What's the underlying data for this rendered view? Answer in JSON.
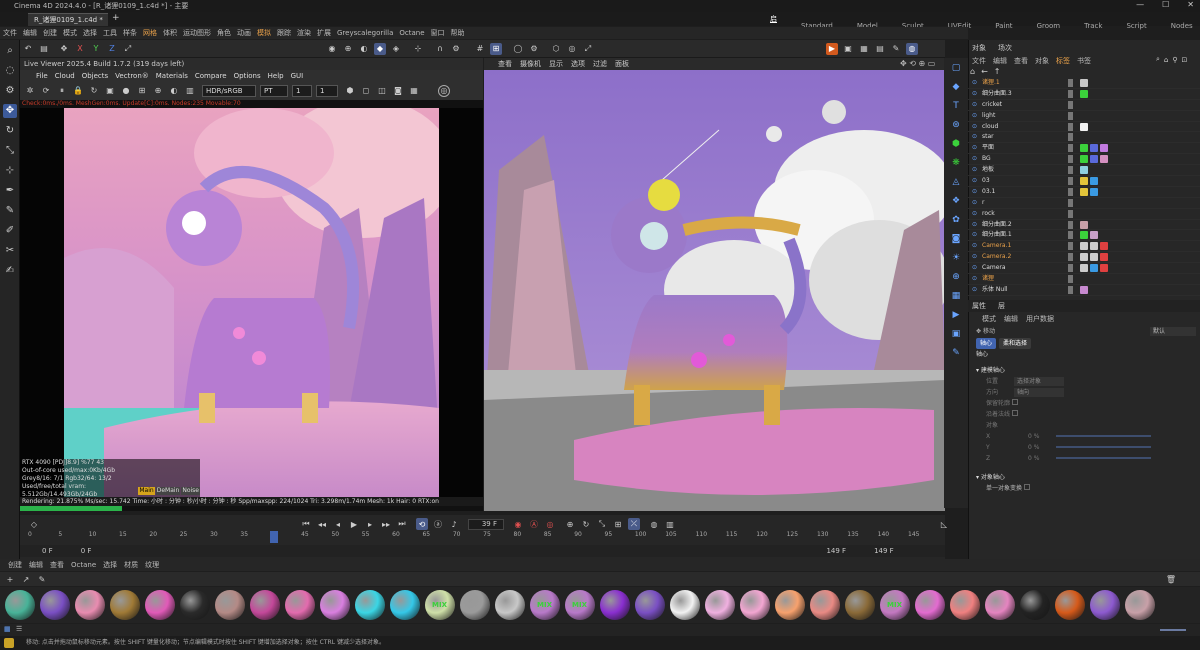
{
  "window": {
    "title": "Cinema 4D 2024.4.0 - [R_诸狸0109_1.c4d *] - 主要",
    "doc_tab": "R_诸狸0109_1.c4d *",
    "add_tab": "+",
    "min": "—",
    "max": "☐",
    "close": "✕"
  },
  "layouts": [
    "启动",
    "Standard",
    "Model",
    "Sculpt",
    "UVEdit",
    "Paint",
    "Groom",
    "Track",
    "Script",
    "Nodes"
  ],
  "menu": [
    "文件",
    "编辑",
    "创建",
    "模式",
    "选择",
    "工具",
    "样条",
    "网格",
    "体积",
    "运动图形",
    "角色",
    "动画",
    "模拟",
    "跟踪",
    "渲染",
    "扩展",
    "Greyscalegorilla",
    "Octane",
    "窗口",
    "帮助"
  ],
  "main_toolbar": {
    "xyz": [
      "X",
      "Y",
      "Z"
    ]
  },
  "live_viewer": {
    "title": "Live Viewer 2025.4 Build 1.7.2 (319 days left)",
    "menu": [
      "File",
      "Cloud",
      "Objects",
      "Vectron®",
      "Materials",
      "Compare",
      "Options",
      "Help",
      "GUI"
    ],
    "colorspace": "HDR/sRGB",
    "mode": "PT",
    "val1": "1",
    "val2": "1",
    "status": "Check:0ms./0ms. MeshGen:0ms. Update[C]:0ms. Nodes:235 Movable:70",
    "info": [
      "RTX 4090 [PDJ]8.9]    %77    43",
      "Out-of-core used/max:0Kb/4Gb",
      "Grey8/16: 7/1         Rgb32/64: 13/2",
      "Used/free/total vram: 5.512Gb/14.493Gb/24Gb"
    ],
    "info_tags": [
      "Main",
      "DeMain",
      "Noise"
    ],
    "render_line": "Rendering: 21.875%   Ms/sec: 15.742   Time: 小时 : 分钟 : 秒/小时 : 分钟 : 秒   Spp/maxspp: 224/1024   Tri: 3.298m/1.74m   Mesh: 1k   Hair: 0   RTX:on",
    "progress": 0.22
  },
  "viewport": {
    "menu": [
      "查看",
      "摄像机",
      "显示",
      "选项",
      "过滤",
      "面板"
    ]
  },
  "timeline": {
    "current": "39 F",
    "ticks": [
      "0",
      "5",
      "10",
      "15",
      "20",
      "25",
      "30",
      "35",
      "40",
      "45",
      "50",
      "55",
      "60",
      "65",
      "70",
      "75",
      "80",
      "85",
      "90",
      "95",
      "100",
      "105",
      "110",
      "115",
      "120",
      "125",
      "130",
      "135",
      "140",
      "145"
    ],
    "start": "0 F",
    "start2": "0 F",
    "end": "149 F",
    "end2": "149 F"
  },
  "material_menu": [
    "创建",
    "编辑",
    "查看",
    "Octane",
    "选择",
    "材质",
    "纹理"
  ],
  "materials": [
    {
      "c": "#48b398",
      "label": ""
    },
    {
      "c": "#7a4fc4",
      "label": ""
    },
    {
      "c": "#e98cb0",
      "label": ""
    },
    {
      "c": "#a07a36",
      "label": ""
    },
    {
      "c": "#e15ab8",
      "label": ""
    },
    {
      "c": "#2a2a2a",
      "label": ""
    },
    {
      "c": "#b48a86",
      "label": ""
    },
    {
      "c": "#c4489a",
      "label": ""
    },
    {
      "c": "#e36bae",
      "label": ""
    },
    {
      "c": "#d97fe0",
      "label": ""
    },
    {
      "c": "#3ad6e5",
      "label": ""
    },
    {
      "c": "#34c8e8",
      "label": ""
    },
    {
      "c": "#cfe0a8",
      "label": "MIX"
    },
    {
      "c": "#9a9a9a",
      "label": ""
    },
    {
      "c": "#c8c8c8",
      "label": ""
    },
    {
      "c": "#b879c9",
      "label": "MIX"
    },
    {
      "c": "#b879c9",
      "label": "MIX"
    },
    {
      "c": "#8a2fd0",
      "label": ""
    },
    {
      "c": "#7a4fc4",
      "label": ""
    },
    {
      "c": "#f2f2f2",
      "label": ""
    },
    {
      "c": "#f0b0e0",
      "label": ""
    },
    {
      "c": "#f3a6d2",
      "label": ""
    },
    {
      "c": "#f7a16d",
      "label": ""
    },
    {
      "c": "#e98a84",
      "label": ""
    },
    {
      "c": "#8a6a38",
      "label": ""
    },
    {
      "c": "#c478c2",
      "label": "MIX"
    },
    {
      "c": "#e36bd0",
      "label": ""
    },
    {
      "c": "#f08080",
      "label": ""
    },
    {
      "c": "#e584c0",
      "label": ""
    },
    {
      "c": "#232323",
      "label": ""
    },
    {
      "c": "#d65a1a",
      "label": ""
    },
    {
      "c": "#8d5ad0",
      "label": ""
    },
    {
      "c": "#c8a0a8",
      "label": ""
    }
  ],
  "status": "移动: 点击并拖动鼠标移动元素。按住 SHIFT 键量化移动；节点编辑模式时按住 SHIFT 键增加选择对象；按住 CTRL 键减少选择对象。",
  "right_panel": {
    "tabs": [
      "对象",
      "场次"
    ],
    "menu": [
      "文件",
      "编辑",
      "查看",
      "对象",
      "标签",
      "书签"
    ],
    "objects": [
      {
        "name": "诸狸.1",
        "color": "#e9a14a",
        "tags": [
          "#c8c8c8"
        ]
      },
      {
        "name": "细分曲面.3",
        "color": "#ddd",
        "tags": [
          "#3bd13b"
        ]
      },
      {
        "name": "cricket",
        "color": "#ddd",
        "tags": []
      },
      {
        "name": "light",
        "color": "#ddd",
        "tags": []
      },
      {
        "name": "cloud",
        "color": "#ddd",
        "tags": [
          "#f2f2f2"
        ]
      },
      {
        "name": "star",
        "color": "#ddd",
        "tags": []
      },
      {
        "name": "平面",
        "color": "#ddd",
        "tags": [
          "#3bd13b",
          "#5a6adb",
          "#c27be0"
        ]
      },
      {
        "name": "BG",
        "color": "#ddd",
        "tags": [
          "#3bd13b",
          "#5a6adb",
          "#d48fc0"
        ]
      },
      {
        "name": "地板",
        "color": "#ddd",
        "tags": [
          "#8fd0e0"
        ]
      },
      {
        "name": "03",
        "color": "#ddd",
        "tags": [
          "#e3c43a",
          "#3a9ae3"
        ]
      },
      {
        "name": "03.1",
        "color": "#ddd",
        "tags": [
          "#e3c43a",
          "#3a9ae3"
        ]
      },
      {
        "name": "r",
        "color": "#ddd",
        "tags": []
      },
      {
        "name": "rock",
        "color": "#ddd",
        "tags": []
      },
      {
        "name": "细分曲面.2",
        "color": "#ddd",
        "tags": [
          "#c8a0a8"
        ]
      },
      {
        "name": "细分曲面.1",
        "color": "#ddd",
        "tags": [
          "#3bd13b",
          "#c8a0c8"
        ]
      },
      {
        "name": "Camera.1",
        "color": "#e9a14a",
        "tags": [
          "#cccccc",
          "#cccccc",
          "#e04040"
        ]
      },
      {
        "name": "Camera.2",
        "color": "#e9a14a",
        "tags": [
          "#cccccc",
          "#cccccc",
          "#e04040"
        ]
      },
      {
        "name": "Camera",
        "color": "#ddd",
        "tags": [
          "#cccccc",
          "#3a9ae3",
          "#e04040"
        ]
      },
      {
        "name": "诸狸",
        "color": "#e9a14a",
        "tags": []
      },
      {
        "name": "乐体 Null",
        "color": "#ddd",
        "tags": [
          "#c88ad0"
        ]
      }
    ],
    "attr_tabs": [
      "属性",
      "层"
    ],
    "attr_menu": [
      "模式",
      "编辑",
      "用户数据"
    ],
    "tool": "移动",
    "preset": "默认",
    "pills": [
      "轴心",
      "柔和选择"
    ],
    "section": "轴心",
    "group1": "▾ 建模轴心",
    "fields": [
      {
        "k": "位置",
        "v": "选择对象"
      },
      {
        "k": "方向",
        "v": "轴向"
      }
    ],
    "checks": [
      "保留轮廓",
      "沿着法线"
    ],
    "sub": "对象",
    "xyz": [
      {
        "k": "X",
        "v": "0 %"
      },
      {
        "k": "Y",
        "v": "0 %"
      },
      {
        "k": "Z",
        "v": "0 %"
      }
    ],
    "group2": "▾ 对象轴心",
    "single": "单一对象变换"
  }
}
